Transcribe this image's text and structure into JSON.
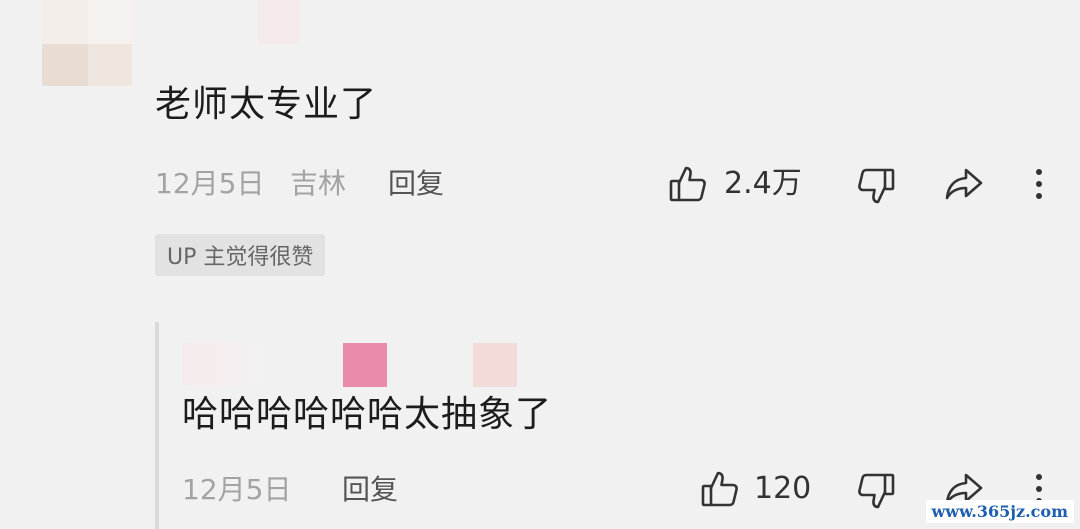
{
  "comment": {
    "text": "老师太专业了",
    "date": "12月5日",
    "location": "吉林",
    "reply_label": "回复",
    "like_count": "2.4万",
    "badge": "UP 主觉得很赞"
  },
  "reply": {
    "text": "哈哈哈哈哈哈太抽象了",
    "date": "12月5日",
    "reply_label": "回复",
    "like_count": "120"
  },
  "icons": [
    "thumbs-up-icon",
    "thumbs-down-icon",
    "share-icon",
    "more-icon"
  ],
  "colors": {
    "background": "#f1f1f1",
    "text": "#1c1c1c",
    "meta": "#a3a3a3",
    "badge_bg": "#e2e2e2"
  },
  "watermark": "www.365jz.com"
}
